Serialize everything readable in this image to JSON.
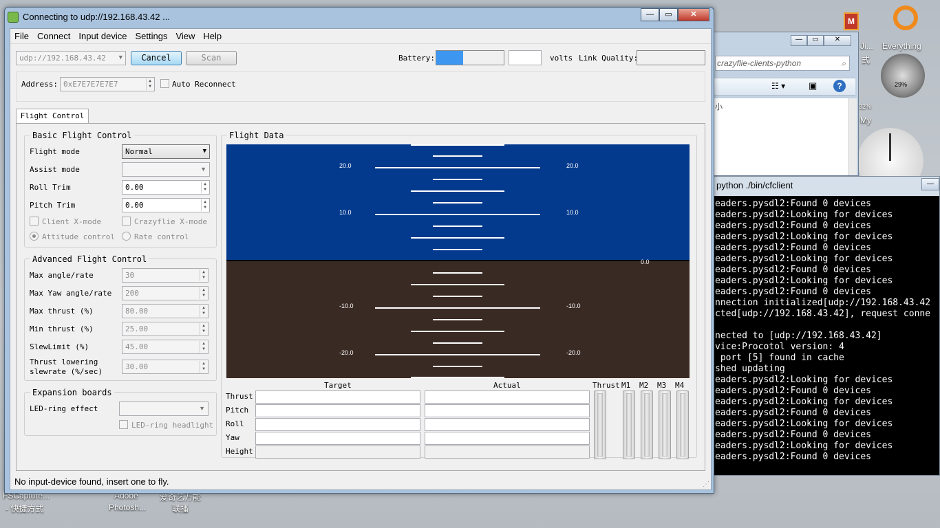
{
  "desktop": {
    "icons": [
      {
        "label": "FSCapture..."
      },
      {
        "label": "- 快捷方式"
      },
      {
        "label": "Adobe"
      },
      {
        "label": "Photosh..."
      },
      {
        "label": "爱奇艺万能"
      },
      {
        "label": "联播"
      },
      {
        "label": "Everything"
      },
      {
        "label": "Ji..."
      },
      {
        "label": "式"
      },
      {
        "label": "My"
      }
    ],
    "gadget_percent": "29%",
    "gadget_percent2": "32%"
  },
  "explorer": {
    "path": "crazyflie-clients-python",
    "side_text": "小"
  },
  "terminal": {
    "title": "python ./bin/cfclient",
    "lines": [
      "eaders.pysdl2:Found 0 devices",
      "eaders.pysdl2:Looking for devices",
      "eaders.pysdl2:Found 0 devices",
      "eaders.pysdl2:Looking for devices",
      "eaders.pysdl2:Found 0 devices",
      "eaders.pysdl2:Looking for devices",
      "eaders.pysdl2:Found 0 devices",
      "eaders.pysdl2:Looking for devices",
      "eaders.pysdl2:Found 0 devices",
      "nnection initialized[udp://192.168.43.42",
      "cted[udp://192.168.43.42], request conne",
      "",
      "nected to [udp://192.168.43.42]",
      "vice:Procotol version: 4",
      " port [5] found in cache",
      "shed updating",
      "eaders.pysdl2:Looking for devices",
      "eaders.pysdl2:Found 0 devices",
      "eaders.pysdl2:Looking for devices",
      "eaders.pysdl2:Found 0 devices",
      "eaders.pysdl2:Looking for devices",
      "eaders.pysdl2:Found 0 devices",
      "eaders.pysdl2:Looking for devices",
      "eaders.pysdl2:Found 0 devices"
    ]
  },
  "window": {
    "title": "Connecting to udp://192.168.43.42 ...",
    "menu": [
      "File",
      "Connect",
      "Input device",
      "Settings",
      "View",
      "Help"
    ]
  },
  "toolbar": {
    "uri": "udp://192.168.43.42",
    "cancel": "Cancel",
    "scan": "Scan",
    "battery_label": "Battery:",
    "battery_level": 0.4,
    "volts_value": "",
    "volts_label": "volts",
    "link_label": "Link Quality:",
    "address_label": "Address:",
    "address_value": "0xE7E7E7E7E7",
    "auto_reconnect": "Auto Reconnect"
  },
  "tabs": [
    "Flight Control"
  ],
  "basic": {
    "title": "Basic Flight Control",
    "flight_mode_label": "Flight mode",
    "flight_mode_value": "Normal",
    "assist_mode_label": "Assist mode",
    "roll_trim_label": "Roll Trim",
    "roll_trim_value": "0.00",
    "pitch_trim_label": "Pitch Trim",
    "pitch_trim_value": "0.00",
    "client_xmode": "Client X-mode",
    "crazyflie_xmode": "Crazyflie X-mode",
    "attitude_control": "Attitude control",
    "rate_control": "Rate control"
  },
  "advanced": {
    "title": "Advanced Flight Control",
    "rows": [
      {
        "label": "Max angle/rate",
        "value": "30"
      },
      {
        "label": "Max Yaw angle/rate",
        "value": "200"
      },
      {
        "label": "Max thrust (%)",
        "value": "80.00"
      },
      {
        "label": "Min thrust (%)",
        "value": "25.00"
      },
      {
        "label": "SlewLimit (%)",
        "value": "45.00"
      }
    ],
    "slew_label_1": "Thrust lowering",
    "slew_label_2": "slewrate (%/sec)",
    "slew_value": "30.00"
  },
  "expansion": {
    "title": "Expansion boards",
    "led_effect_label": "LED-ring effect",
    "led_headlight": "LED-ring headlight"
  },
  "flight_data": {
    "title": "Flight Data",
    "ladder_labels": [
      "20.0",
      "20.0",
      "10.0",
      "10.0",
      "0.0",
      "-10.0",
      "-10.0",
      "-20.0",
      "-20.0"
    ],
    "sky_color": "#043a8d",
    "ground_color": "#3a2a24",
    "target_header": "Target",
    "actual_header": "Actual",
    "rows": [
      "Thrust",
      "Pitch",
      "Roll",
      "Yaw",
      "Height"
    ],
    "bars": [
      "Thrust",
      "M1",
      "M2",
      "M3",
      "M4"
    ]
  },
  "status": "No input-device found, insert one to fly."
}
